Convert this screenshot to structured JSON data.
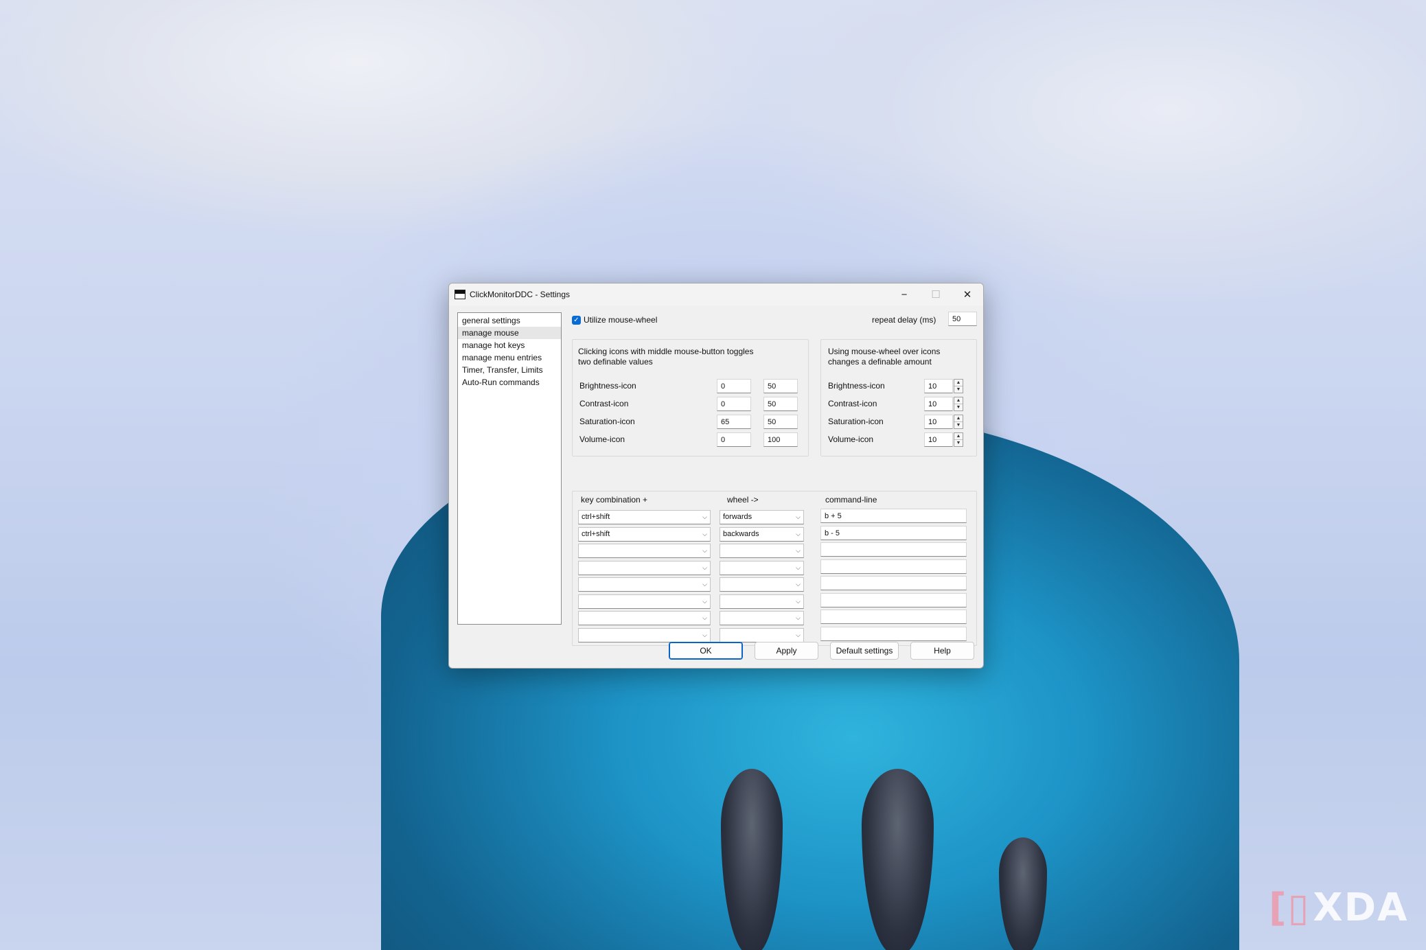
{
  "window": {
    "title": "ClickMonitorDDC - Settings",
    "minimize": "−",
    "maximize": "☐",
    "close": "✕"
  },
  "nav": {
    "items": [
      {
        "label": "general settings",
        "selected": false
      },
      {
        "label": "manage mouse",
        "selected": true
      },
      {
        "label": "manage hot keys",
        "selected": false
      },
      {
        "label": "manage menu entries",
        "selected": false
      },
      {
        "label": "Timer, Transfer, Limits",
        "selected": false
      },
      {
        "label": "Auto-Run commands",
        "selected": false
      }
    ]
  },
  "mouse_wheel": {
    "checkbox_label": "Utilize mouse-wheel",
    "checked": true,
    "repeat_delay_label": "repeat delay (ms)",
    "repeat_delay_value": "50"
  },
  "middle_button": {
    "description_line1": "Clicking icons with middle mouse-button toggles",
    "description_line2": "two definable values",
    "rows": [
      {
        "label": "Brightness-icon",
        "value1": "0",
        "value2": "50"
      },
      {
        "label": "Contrast-icon",
        "value1": "0",
        "value2": "50"
      },
      {
        "label": "Saturation-icon",
        "value1": "65",
        "value2": "50"
      },
      {
        "label": "Volume-icon",
        "value1": "0",
        "value2": "100"
      }
    ]
  },
  "wheel_amount": {
    "description_line1": "Using mouse-wheel over icons",
    "description_line2": "changes a definable amount",
    "rows": [
      {
        "label": "Brightness-icon",
        "value": "10"
      },
      {
        "label": "Contrast-icon",
        "value": "10"
      },
      {
        "label": "Saturation-icon",
        "value": "10"
      },
      {
        "label": "Volume-icon",
        "value": "10"
      }
    ]
  },
  "commands": {
    "header_key": "key combination  +",
    "header_wheel": "wheel  ->",
    "header_command": "command-line",
    "rows": [
      {
        "key": "ctrl+shift",
        "wheel": "forwards",
        "command": "b + 5"
      },
      {
        "key": "ctrl+shift",
        "wheel": "backwards",
        "command": "b - 5"
      },
      {
        "key": "",
        "wheel": "",
        "command": ""
      },
      {
        "key": "",
        "wheel": "",
        "command": ""
      },
      {
        "key": "",
        "wheel": "",
        "command": ""
      },
      {
        "key": "",
        "wheel": "",
        "command": ""
      },
      {
        "key": "",
        "wheel": "",
        "command": ""
      },
      {
        "key": "",
        "wheel": "",
        "command": ""
      }
    ]
  },
  "buttons": {
    "ok": "OK",
    "apply": "Apply",
    "default": "Default settings",
    "help": "Help"
  },
  "watermark": {
    "text": "XDA"
  },
  "icons": {
    "spin_up": "▲",
    "spin_down": "▼",
    "dropdown": "⌵",
    "check": "✓"
  }
}
